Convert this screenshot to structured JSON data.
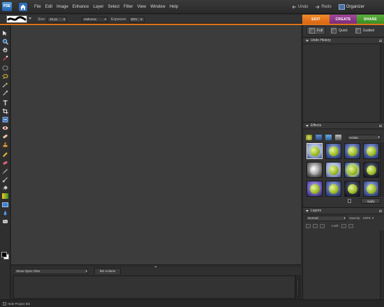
{
  "app": {
    "logo_text": "PSE"
  },
  "menu": [
    "File",
    "Edit",
    "Image",
    "Enhance",
    "Layer",
    "Select",
    "Filter",
    "View",
    "Window",
    "Help"
  ],
  "history_buttons": {
    "undo": "Undo",
    "redo": "Redo",
    "organizer": "Organizer"
  },
  "options_bar": {
    "size_label": "Size:",
    "size_value": "25 px",
    "range_value": "Midtones",
    "exposure_label": "Exposure:",
    "exposure_value": "50%"
  },
  "mode_tabs": {
    "edit": "EDIT",
    "create": "CREATE",
    "share": "SHARE"
  },
  "edit_modes": {
    "full": "Full",
    "quick": "Quick",
    "guided": "Guided"
  },
  "panels": {
    "undo_history": "Undo History",
    "effects": "Effects",
    "effects_category": "Artistic",
    "apply": "Apply",
    "layers": "Layers",
    "blend_mode": "Normal",
    "opacity_label": "Opacity:",
    "opacity_value": "100%",
    "lock_label": "Lock:"
  },
  "project_bin": {
    "select_value": "Show Open Files",
    "bin_actions": "Bin Actions"
  },
  "statusbar": {
    "hide_bin": "Hide Project Bin"
  },
  "colors": {
    "edit_tab": "#e07820",
    "create_tab": "#8a3888",
    "share_tab": "#4a9c30",
    "accent_line": "#e0741a"
  }
}
